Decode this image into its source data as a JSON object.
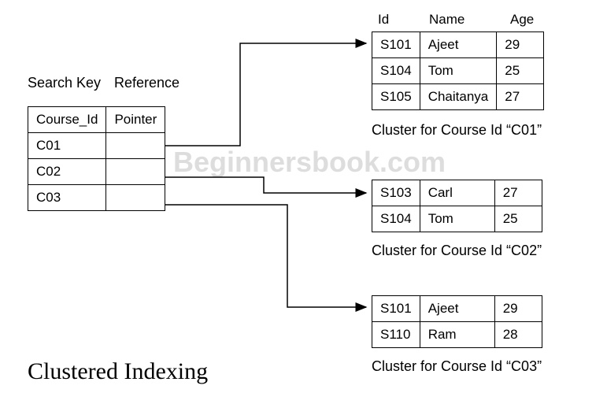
{
  "labels": {
    "search_key": "Search Key",
    "reference": "Reference"
  },
  "index_table": {
    "headers": [
      "Course_Id",
      "Pointer"
    ],
    "rows": [
      {
        "id": "C01",
        "ptr": ""
      },
      {
        "id": "C02",
        "ptr": ""
      },
      {
        "id": "C03",
        "ptr": ""
      }
    ]
  },
  "cluster_headers": {
    "id": "Id",
    "name": "Name",
    "age": "Age"
  },
  "clusters": [
    {
      "caption": "Cluster for Course Id “C01”",
      "rows": [
        {
          "id": "S101",
          "name": "Ajeet",
          "age": "29"
        },
        {
          "id": "S104",
          "name": "Tom",
          "age": "25"
        },
        {
          "id": "S105",
          "name": "Chaitanya",
          "age": "27"
        }
      ]
    },
    {
      "caption": "Cluster for Course Id “C02”",
      "rows": [
        {
          "id": "S103",
          "name": "Carl",
          "age": "27"
        },
        {
          "id": "S104",
          "name": "Tom",
          "age": "25"
        }
      ]
    },
    {
      "caption": "Cluster for Course Id “C03”",
      "rows": [
        {
          "id": "S101",
          "name": "Ajeet",
          "age": "29"
        },
        {
          "id": "S110",
          "name": "Ram",
          "age": "28"
        }
      ]
    }
  ],
  "title": "Clustered Indexing",
  "watermark": "Beginnersbook.com"
}
